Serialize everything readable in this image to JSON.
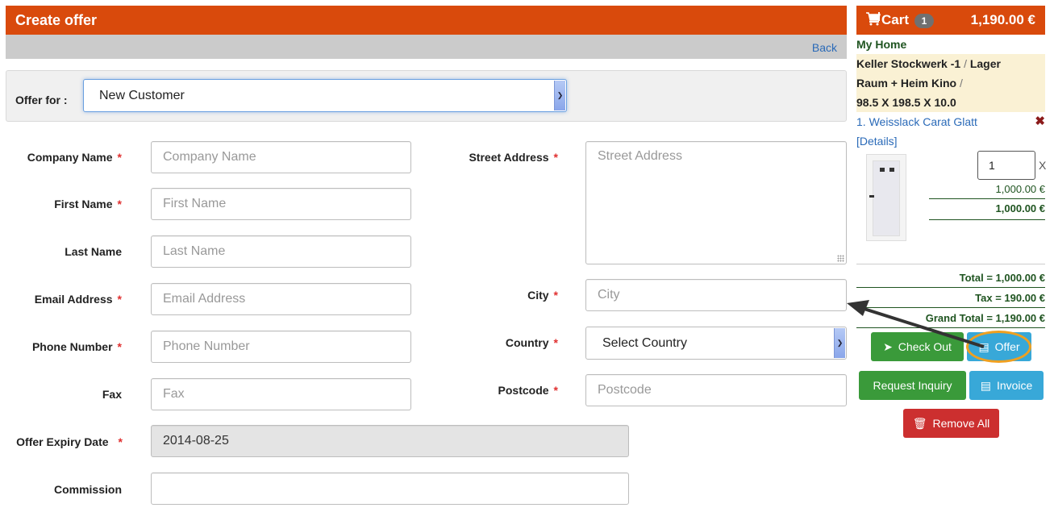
{
  "page": {
    "title": "Create offer",
    "back_link": "Back"
  },
  "offer_for": {
    "label": "Offer for :",
    "selected": "New Customer"
  },
  "form": {
    "left": [
      {
        "label": "Company Name",
        "required": true,
        "placeholder": "Company Name",
        "value": ""
      },
      {
        "label": "First Name",
        "required": true,
        "placeholder": "First Name",
        "value": ""
      },
      {
        "label": "Last Name",
        "required": false,
        "placeholder": "Last Name",
        "value": ""
      },
      {
        "label": "Email Address",
        "required": true,
        "placeholder": "Email Address",
        "value": ""
      },
      {
        "label": "Phone Number",
        "required": true,
        "placeholder": "Phone Number",
        "value": ""
      },
      {
        "label": "Fax",
        "required": false,
        "placeholder": "Fax",
        "value": ""
      }
    ],
    "right": {
      "street": {
        "label": "Street Address",
        "required": true,
        "placeholder": "Street Address"
      },
      "city": {
        "label": "City",
        "required": true,
        "placeholder": "City"
      },
      "country": {
        "label": "Country",
        "required": true,
        "selected": "Select Country"
      },
      "postcode": {
        "label": "Postcode",
        "required": true,
        "placeholder": "Postcode"
      }
    },
    "expiry": {
      "label": "Offer Expiry Date",
      "required": true,
      "value": "2014-08-25"
    },
    "commission": {
      "label": "Commission",
      "required": false,
      "value": ""
    },
    "required_mark": "*"
  },
  "cart": {
    "icon": "shopping-cart-icon",
    "label": "Cart",
    "count": "1",
    "header_total": "1,190.00 €",
    "home": "My Home",
    "room_line1": "Keller Stockwerk -1",
    "room_line1b": "Lager",
    "room_line2": "Raum + Heim Kino",
    "room_line3": "98.5 X 198.5 X 10.0",
    "slash": "/",
    "item": {
      "name": "1. Weisslack Carat Glatt",
      "details": "[Details]",
      "quantity": "1",
      "times": "X",
      "unit_price": "1,000.00 €",
      "line_total": "1,000.00 €"
    },
    "total": "Total = 1,000.00 €",
    "tax": "Tax = 190.00 €",
    "grand_total": "Grand Total = 1,190.00 €",
    "buttons": {
      "checkout": "Check Out",
      "offer": "Offer",
      "inquiry": "Request Inquiry",
      "invoice": "Invoice",
      "remove_all": "Remove All"
    }
  },
  "colors": {
    "brand_orange": "#d94a0c",
    "green": "#3a9a3a",
    "blue": "#38a8d8",
    "red": "#cc2f2f",
    "highlight": "#f0a020"
  }
}
